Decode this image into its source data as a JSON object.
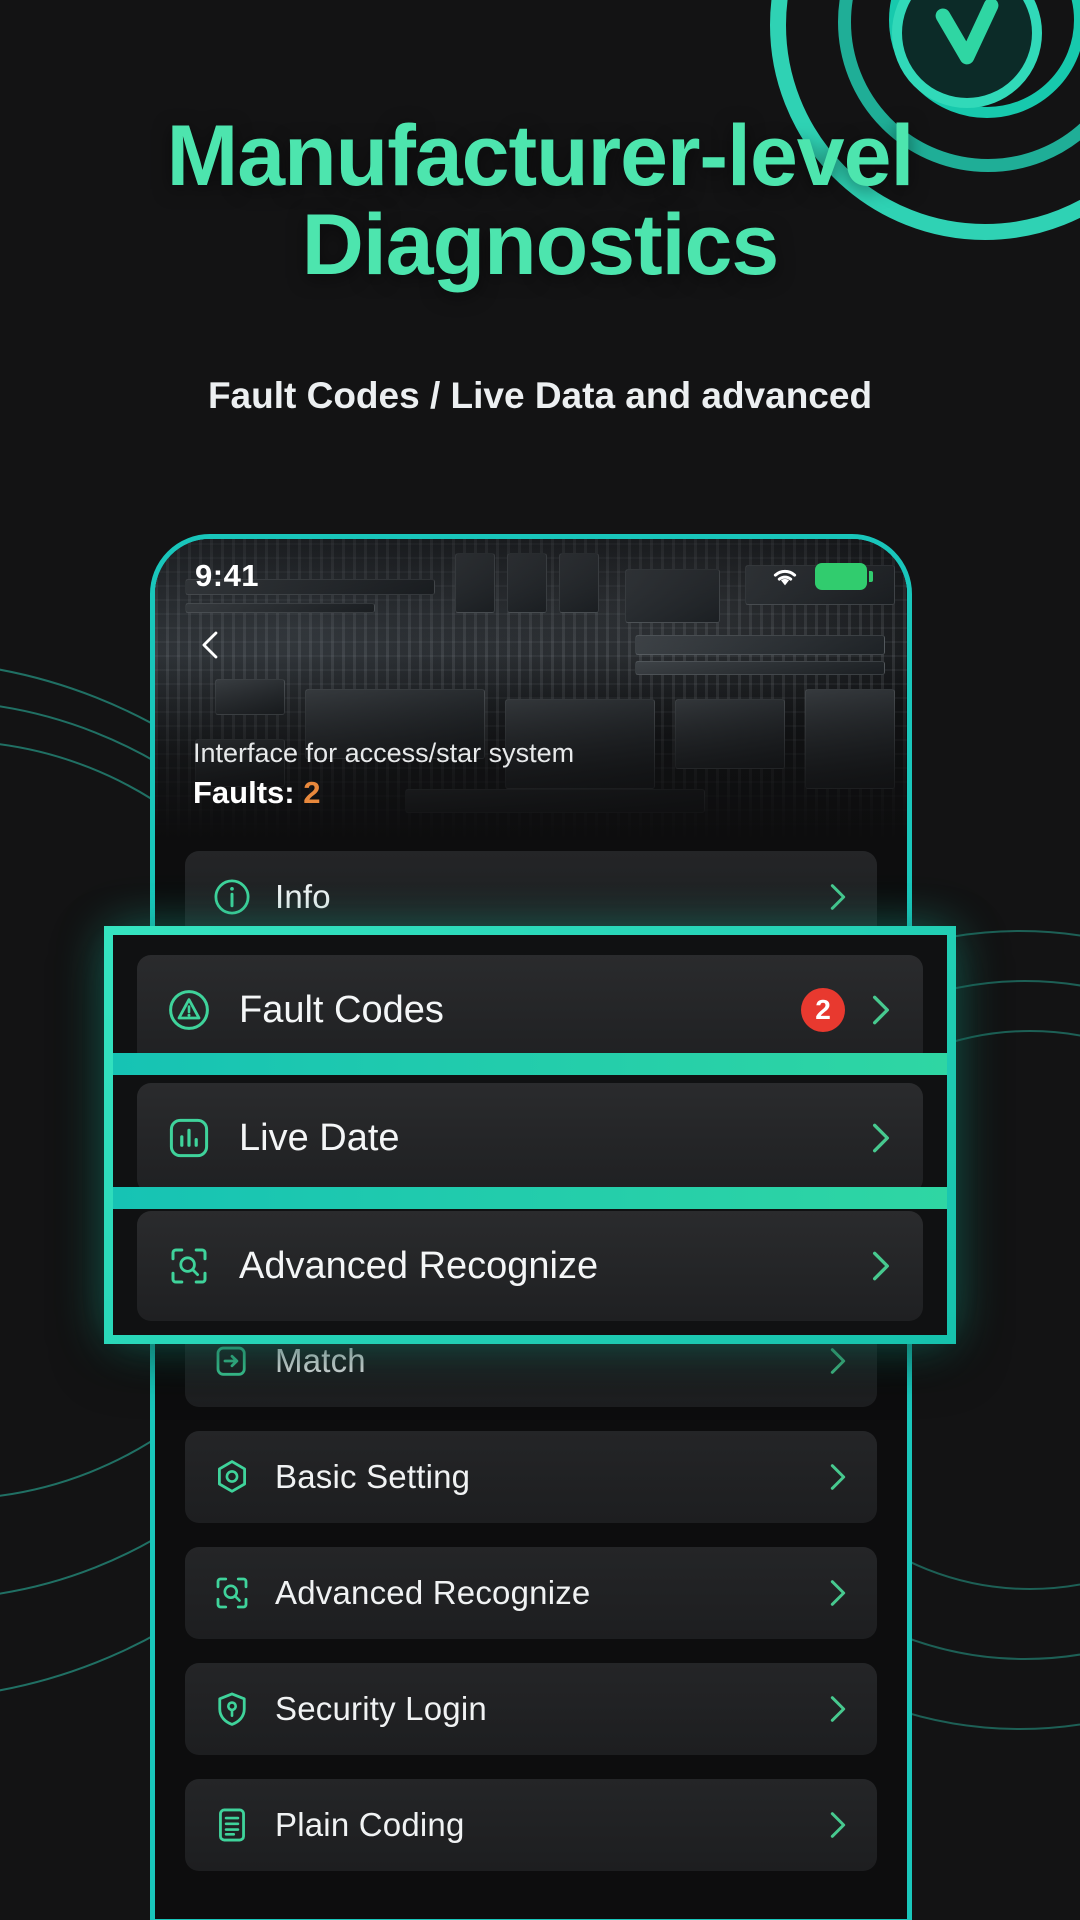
{
  "hero": {
    "headline_line1": "Manufacturer-level",
    "headline_line2": "Diagnostics",
    "subtitle": "Fault Codes / Live Data and advanced",
    "accent_color": "#4de5ae",
    "logo_icon": "check-mark-logo"
  },
  "phone": {
    "status_bar": {
      "time": "9:41",
      "wifi_icon": "wifi-icon",
      "battery_icon": "battery-full-icon",
      "battery_color": "#31cc6e"
    },
    "header": {
      "back_icon": "chevron-left-icon",
      "subtitle": "Interface for access/star system",
      "faults_label": "Faults:",
      "faults_count": "2",
      "faults_count_color": "#e8883c"
    },
    "menu": [
      {
        "label": "Info",
        "icon": "info-circle-icon",
        "badge": "",
        "chevron": "chevron-right-icon"
      },
      {
        "label": "Fault Codes",
        "icon": "warning-triangle-icon",
        "badge": "2",
        "chevron": "chevron-right-icon"
      },
      {
        "label": "Live Date",
        "icon": "bar-chart-icon",
        "badge": "",
        "chevron": "chevron-right-icon"
      },
      {
        "label": "Advanced Recognize",
        "icon": "scan-search-icon",
        "badge": "",
        "chevron": "chevron-right-icon"
      },
      {
        "label": "Match",
        "icon": "match-arrow-icon",
        "badge": "",
        "chevron": "chevron-right-icon"
      },
      {
        "label": "Basic Setting",
        "icon": "hexagon-gear-icon",
        "badge": "",
        "chevron": "chevron-right-icon"
      },
      {
        "label": "Advanced Recognize",
        "icon": "scan-search-icon",
        "badge": "",
        "chevron": "chevron-right-icon"
      },
      {
        "label": "Security Login",
        "icon": "shield-key-icon",
        "badge": "",
        "chevron": "chevron-right-icon"
      },
      {
        "label": "Plain Coding",
        "icon": "document-lines-icon",
        "badge": "",
        "chevron": "chevron-right-icon"
      }
    ]
  },
  "callout": {
    "border_color": "#2fd6a3",
    "items": [
      {
        "label": "Fault Codes",
        "icon": "warning-triangle-icon",
        "badge": "2",
        "chevron": "chevron-right-icon"
      },
      {
        "label": "Live Date",
        "icon": "bar-chart-icon",
        "badge": "",
        "chevron": "chevron-right-icon"
      },
      {
        "label": "Advanced Recognize",
        "icon": "scan-search-icon",
        "badge": "",
        "chevron": "chevron-right-icon"
      }
    ]
  }
}
